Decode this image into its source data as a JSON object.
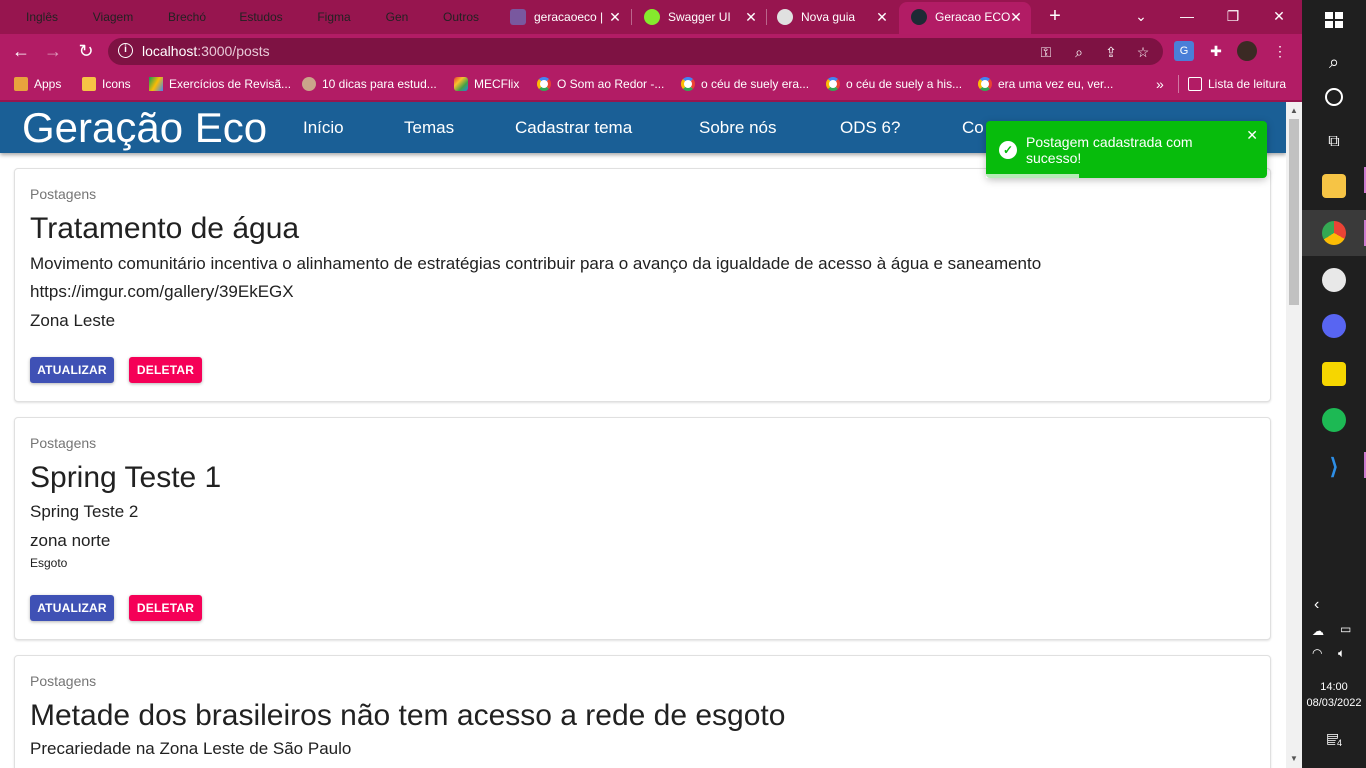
{
  "browser": {
    "tab_groups": [
      {
        "label": "Inglês",
        "color": "#7fc98a"
      },
      {
        "label": "Viagem",
        "color": "#f28b82"
      },
      {
        "label": "Brechó",
        "color": "#78d3f0"
      },
      {
        "label": "Estudos",
        "color": "#fdd663"
      },
      {
        "label": "Figma",
        "color": "#e8a5f5"
      },
      {
        "label": "Gen",
        "color": "#fcad70"
      },
      {
        "label": "Outros",
        "color": "#dadce0"
      }
    ],
    "tabs": [
      {
        "title": "geracaoeco |",
        "icon": "heroku-icon",
        "color": "#79589f"
      },
      {
        "title": "Swagger UI",
        "icon": "swagger-icon",
        "color": "#85ea2d"
      },
      {
        "title": "Nova guia",
        "icon": "chrome-icon",
        "color": "#e0e0e0"
      },
      {
        "title": "Geracao ECO",
        "icon": "react-icon",
        "color": "#1e2a35"
      }
    ],
    "url_host": "localhost",
    "url_path": ":3000/posts",
    "bookmarks": [
      {
        "label": "Apps",
        "icon": "apps-grid-icon"
      },
      {
        "label": "Icons",
        "icon": "folder-icon"
      },
      {
        "label": "Exercícios de Revisã...",
        "icon": "drive-icon"
      },
      {
        "label": "10 dicas para estud...",
        "icon": "avatar-icon"
      },
      {
        "label": "MECFlix",
        "icon": "mecflix-icon"
      },
      {
        "label": "O Som ao Redor -...",
        "icon": "google-icon"
      },
      {
        "label": "o céu de suely era...",
        "icon": "google-icon"
      },
      {
        "label": "o céu de suely a his...",
        "icon": "google-icon"
      },
      {
        "label": "era uma vez eu, ver...",
        "icon": "google-icon"
      }
    ],
    "reading_list": "Lista de leitura"
  },
  "app": {
    "logo": "Geração Eco",
    "nav": [
      "Início",
      "Temas",
      "Cadastrar tema",
      "Sobre nós",
      "ODS 6?",
      "Co"
    ]
  },
  "posts": [
    {
      "overline": "Postagens",
      "title": "Tratamento de água",
      "text": "Movimento comunitário incentiva o alinhamento de estratégias contribuir para o avanço da igualdade de acesso à água e saneamento",
      "line2": "https://imgur.com/gallery/39EkEGX",
      "line3": "Zona Leste"
    },
    {
      "overline": "Postagens",
      "title": "Spring Teste 1",
      "text": "Spring Teste 2",
      "line2": "zona norte",
      "theme": "Esgoto"
    },
    {
      "overline": "Postagens",
      "title": "Metade dos brasileiros não tem acesso a rede de esgoto",
      "text": "Precariedade na Zona Leste de São Paulo"
    }
  ],
  "buttons": {
    "update": "ATUALIZAR",
    "delete": "DELETAR"
  },
  "toast": {
    "message": "Postagem cadastrada com sucesso!",
    "progress": 0.33
  },
  "system": {
    "time": "14:00",
    "date": "08/03/2022",
    "notifications": "4"
  }
}
